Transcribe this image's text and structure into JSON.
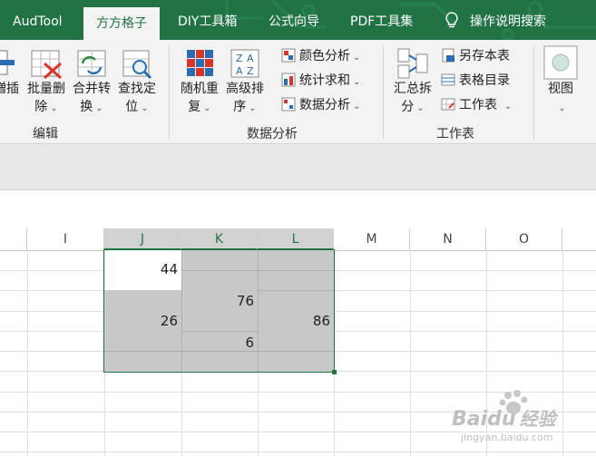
{
  "tabs": [
    {
      "label": "AudTool",
      "active": false
    },
    {
      "label": "方方格子",
      "active": true
    },
    {
      "label": "DIY工具箱",
      "active": false
    },
    {
      "label": "公式向导",
      "active": false
    },
    {
      "label": "PDF工具集",
      "active": false
    }
  ],
  "search": {
    "label": "操作说明搜索"
  },
  "ribbon": {
    "edit_group": {
      "label": "编辑",
      "partial_label": "増插",
      "buttons": [
        {
          "line1": "批量删",
          "line2": "除"
        },
        {
          "line1": "合并转",
          "line2": "换"
        },
        {
          "line1": "查找定",
          "line2": "位"
        }
      ]
    },
    "analysis_group": {
      "label": "数据分析",
      "buttons": [
        {
          "line1": "随机重",
          "line2": "复"
        },
        {
          "line1": "高级排",
          "line2": "序"
        }
      ],
      "small_buttons": [
        "颜色分析",
        "统计求和",
        "数据分析"
      ]
    },
    "worksheet_group": {
      "label": "工作表",
      "button": {
        "line1": "汇总拆",
        "line2": "分"
      },
      "small_buttons": [
        "另存本表",
        "表格目录",
        "工作表"
      ]
    },
    "view_group": {
      "label": "视图"
    }
  },
  "columns": [
    "I",
    "J",
    "K",
    "L",
    "M",
    "N",
    "O"
  ],
  "selected_columns": [
    "J",
    "K",
    "L"
  ],
  "cells": {
    "j1": "44",
    "j_merged": "26",
    "k_merged": "76",
    "k_lower": "6",
    "l_merged": "86"
  },
  "colors": {
    "accent": "#217346",
    "selection_fill": "#c8c8c8"
  },
  "watermark": {
    "brand": "Baidu",
    "brand_cn": "经验",
    "url": "jingyan.baidu.com"
  }
}
